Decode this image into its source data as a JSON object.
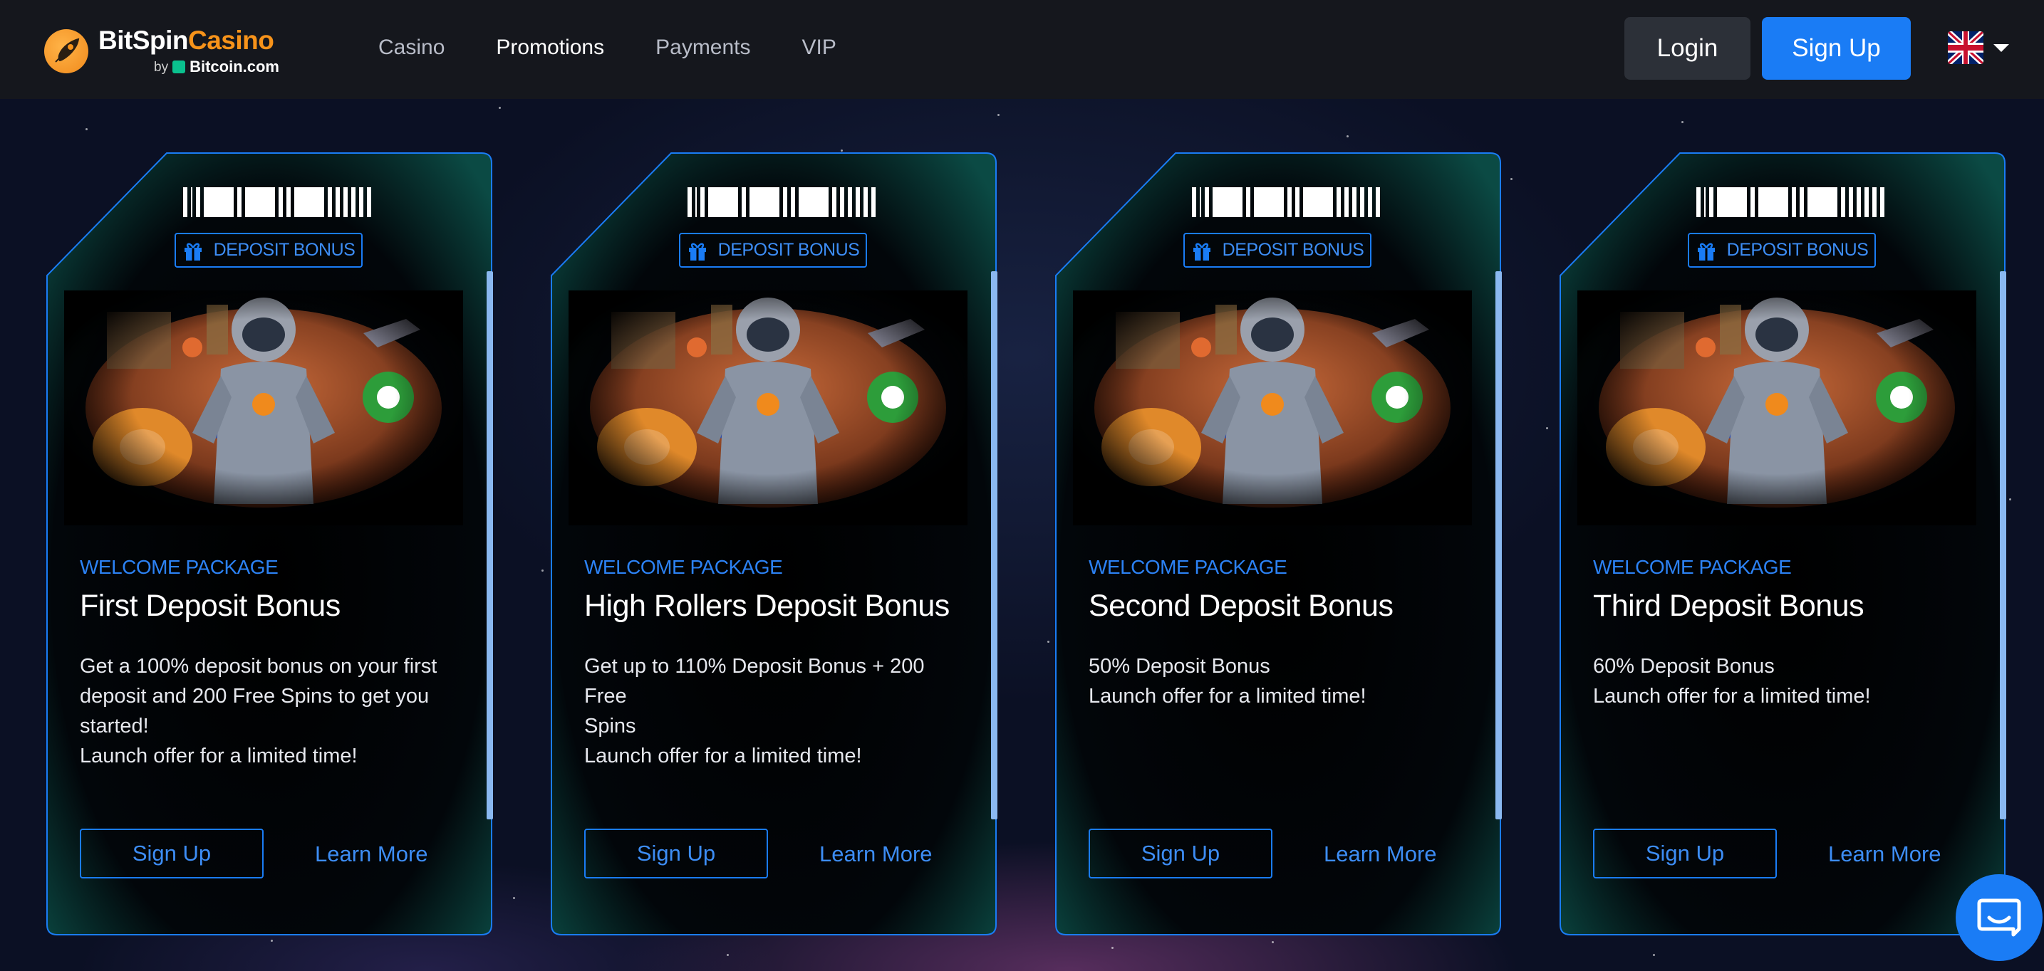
{
  "header": {
    "logo": {
      "name_part1": "BitSpin",
      "name_part2": "Casino",
      "by_text": "by",
      "by_brand": "Bitcoin.com"
    },
    "nav": [
      {
        "label": "Casino",
        "active": false
      },
      {
        "label": "Promotions",
        "active": true
      },
      {
        "label": "Payments",
        "active": false
      },
      {
        "label": "VIP",
        "active": false
      }
    ],
    "login_label": "Login",
    "signup_label": "Sign Up",
    "language_flag": "uk-flag-icon"
  },
  "cards": [
    {
      "badge": "DEPOSIT BONUS",
      "subtitle": "WELCOME PACKAGE",
      "title": "First Deposit Bonus",
      "description": "Get a 100% deposit bonus on your first\ndeposit and 200 Free Spins to get you\nstarted!\nLaunch offer for a limited time!",
      "signup_label": "Sign Up",
      "learn_label": "Learn More"
    },
    {
      "badge": "DEPOSIT BONUS",
      "subtitle": "WELCOME PACKAGE",
      "title": "High Rollers Deposit Bonus",
      "description": "Get up to 110% Deposit Bonus + 200 Free\nSpins\nLaunch offer for a limited time!",
      "signup_label": "Sign Up",
      "learn_label": "Learn More"
    },
    {
      "badge": "DEPOSIT BONUS",
      "subtitle": "WELCOME PACKAGE",
      "title": "Second Deposit Bonus",
      "description": "50% Deposit Bonus\nLaunch offer for a limited time!",
      "signup_label": "Sign Up",
      "learn_label": "Learn More"
    },
    {
      "badge": "DEPOSIT BONUS",
      "subtitle": "WELCOME PACKAGE",
      "title": "Third Deposit Bonus",
      "description": "60% Deposit Bonus\nLaunch offer for a limited time!",
      "signup_label": "Sign Up",
      "learn_label": "Learn More"
    }
  ],
  "colors": {
    "accent": "#1a7cf5",
    "brand_orange": "#f7931a",
    "header_bg": "#15171d"
  },
  "chat_icon": "chat-bubble-icon"
}
